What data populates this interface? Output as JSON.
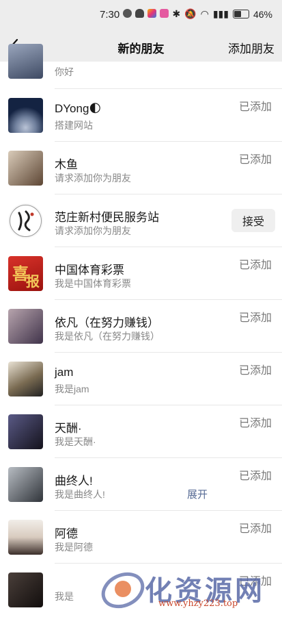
{
  "status_bar": {
    "time": "7:30",
    "battery": "46%"
  },
  "nav": {
    "title": "新的朋友",
    "add_friend": "添加朋友"
  },
  "rows": [
    {
      "name": "",
      "message": "你好",
      "status": "",
      "avatar_color": "#6b7a95"
    },
    {
      "name": "DYong🌓",
      "message": "搭建网站",
      "status": "已添加",
      "avatar_color": "#1e2c4a"
    },
    {
      "name": "木鱼",
      "message": "请求添加你为朋友",
      "status": "已添加",
      "avatar_color": "#6b5442"
    },
    {
      "name": "范庄新村便民服务站",
      "message": "请求添加你为朋友",
      "status": "接受",
      "avatar_color": "#f2f2f2"
    },
    {
      "name": "中国体育彩票",
      "message": "我是中国体育彩票",
      "status": "已添加",
      "avatar_color": "#c8241c"
    },
    {
      "name": "依凡（在努力赚钱）",
      "message": "我是依凡（在努力赚钱）",
      "status": "已添加",
      "avatar_color": "#7a6774"
    },
    {
      "name": "jam",
      "message": "我是jam",
      "status": "已添加",
      "avatar_color": "#8c7c64"
    },
    {
      "name": "天酬·",
      "message": "我是天酬·",
      "status": "已添加",
      "avatar_color": "#2c2a3a"
    },
    {
      "name": "曲终人!",
      "message": "我是曲终人!",
      "status": "已添加",
      "expand": "展开",
      "avatar_color": "#54585e"
    },
    {
      "name": "阿德",
      "message": "我是阿德",
      "status": "已添加",
      "avatar_color": "#d9d2cc"
    },
    {
      "name": "",
      "message": "我是",
      "status": "已添加",
      "avatar_color": "#2a2422"
    }
  ],
  "watermark": {
    "text": "化资源网",
    "url": "www.yhzy223.top"
  }
}
